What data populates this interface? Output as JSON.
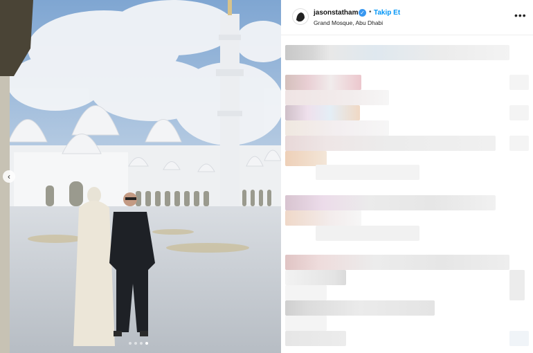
{
  "post": {
    "username": "jasonstatham",
    "separator": "•",
    "follow_label": "Takip Et",
    "location": "Grand Mosque, Abu Dhabi",
    "more_glyph": "•••",
    "prev_glyph": "‹"
  },
  "carousel": {
    "total_slides": 4,
    "active_slide": 4
  },
  "colors": {
    "follow": "#0095f6",
    "verified": "#3897f0"
  }
}
